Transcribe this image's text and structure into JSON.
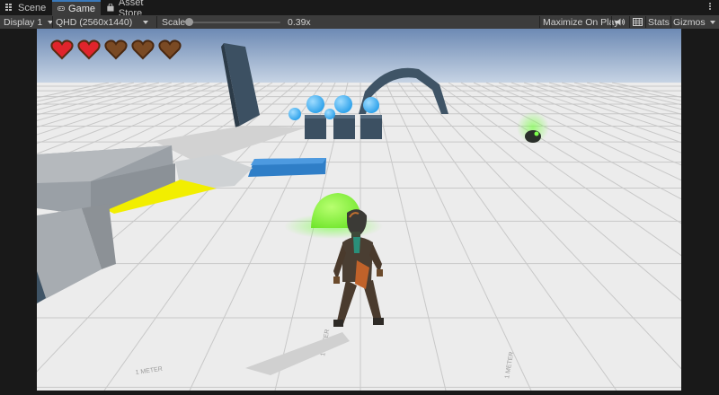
{
  "tabs": [
    {
      "label": "Scene",
      "icon": "scene-grid-icon",
      "active": false
    },
    {
      "label": "Game",
      "icon": "gamepad-icon",
      "active": true
    },
    {
      "label": "Asset Store",
      "icon": "shopping-bag-icon",
      "active": false
    }
  ],
  "toolbar": {
    "display": "Display 1",
    "resolution": "QHD (2560x1440)",
    "scale_label": "Scale",
    "scale_value": "0.39x",
    "maximize_label": "Maximize On Play",
    "mute_icon": "speaker-icon",
    "stats_icon": "stats-grid-icon",
    "stats_label": "Stats",
    "gizmos_label": "Gizmos"
  },
  "hud": {
    "hearts": [
      {
        "state": "full",
        "color": "#e0242c"
      },
      {
        "state": "full",
        "color": "#e0242c"
      },
      {
        "state": "empty",
        "color": "#7a4a24"
      },
      {
        "state": "empty",
        "color": "#7a4a24"
      },
      {
        "state": "empty",
        "color": "#7a4a24"
      }
    ]
  },
  "scene": {
    "floor_marker_text": "1 METER",
    "colors": {
      "sky_top": "#6d8ab4",
      "sky_horizon": "#c9d6e6",
      "floor": "#ececec",
      "platform_blue": "#2f7ec7",
      "orb_blue": "#2aa0ea",
      "blob_green": "#6ee52a",
      "ramp_yellow": "#f2ee00",
      "arch_dark": "#3f5466"
    }
  }
}
